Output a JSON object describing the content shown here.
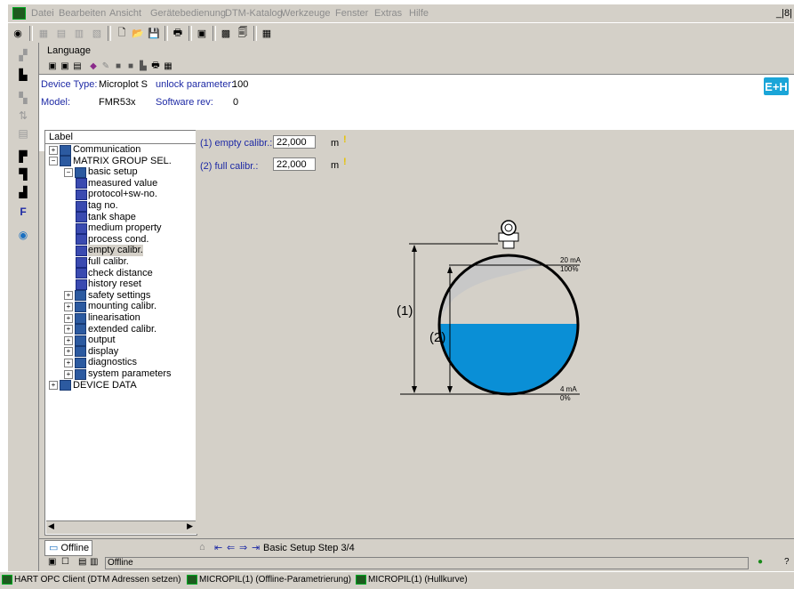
{
  "menu": {
    "items": [
      "Datei",
      "Bearbeiten",
      "Ansicht",
      "Gerätebedienung",
      "DTM-Katalog",
      "Werkzeuge",
      "Fenster",
      "Extras",
      "Hilfe"
    ],
    "window_controls": "_|8|"
  },
  "language_label": "Language",
  "device": {
    "type_label": "Device Type:",
    "type_value": "Microplot S",
    "unlock_label": "unlock parameter:",
    "unlock_value": "100",
    "model_label": "Model:",
    "model_value": "FMR53x",
    "sw_label": "Software rev:",
    "sw_value": "0",
    "logo_text": "E+H"
  },
  "tree": {
    "header": "Label",
    "items": [
      {
        "label": "Communication",
        "level": 0,
        "type": "folder",
        "expander": "+"
      },
      {
        "label": "MATRIX GROUP SEL.",
        "level": 0,
        "type": "folder",
        "expander": "−"
      },
      {
        "label": "basic setup",
        "level": 1,
        "type": "folder",
        "expander": "−"
      },
      {
        "label": "measured value",
        "level": 2,
        "type": "leaf"
      },
      {
        "label": "protocol+sw-no.",
        "level": 2,
        "type": "leaf"
      },
      {
        "label": "tag no.",
        "level": 2,
        "type": "leaf"
      },
      {
        "label": "tank shape",
        "level": 2,
        "type": "leaf"
      },
      {
        "label": "medium property",
        "level": 2,
        "type": "leaf"
      },
      {
        "label": "process cond.",
        "level": 2,
        "type": "leaf"
      },
      {
        "label": "empty calibr.",
        "level": 2,
        "type": "leaf",
        "selected": true
      },
      {
        "label": "full calibr.",
        "level": 2,
        "type": "leaf"
      },
      {
        "label": "check distance",
        "level": 2,
        "type": "leaf"
      },
      {
        "label": "history reset",
        "level": 2,
        "type": "leaf"
      },
      {
        "label": "safety settings",
        "level": 1,
        "type": "folder",
        "expander": "+"
      },
      {
        "label": "mounting calibr.",
        "level": 1,
        "type": "folder",
        "expander": "+"
      },
      {
        "label": "linearisation",
        "level": 1,
        "type": "folder",
        "expander": "+"
      },
      {
        "label": "extended calibr.",
        "level": 1,
        "type": "folder",
        "expander": "+"
      },
      {
        "label": "output",
        "level": 1,
        "type": "folder",
        "expander": "+"
      },
      {
        "label": "display",
        "level": 1,
        "type": "folder",
        "expander": "+"
      },
      {
        "label": "diagnostics",
        "level": 1,
        "type": "folder",
        "expander": "+"
      },
      {
        "label": "system parameters",
        "level": 1,
        "type": "folder",
        "expander": "+"
      },
      {
        "label": "DEVICE DATA",
        "level": 0,
        "type": "folder",
        "expander": "+"
      }
    ]
  },
  "params": {
    "empty_label": "(1) empty calibr.:",
    "empty_value": "22,000",
    "empty_unit": "m",
    "full_label": "(2) full calibr.:",
    "full_value": "22,000",
    "full_unit": "m"
  },
  "diagram": {
    "label_1": "(1)",
    "label_2": "(2)",
    "top_ma": "20 mA",
    "top_pct": "100%",
    "bot_ma": "4 mA",
    "bot_pct": "0%",
    "liquid_color": "#0a8fd6",
    "cone_color": "#c8c8c8"
  },
  "tabs": {
    "offline": "Offline"
  },
  "step_label": "Basic Setup Step 3/4",
  "status": {
    "text": "Offline"
  },
  "taskbar": {
    "items": [
      "HART OPC Client (DTM Adressen setzen)",
      "MICROPIL(1) (Offline-Parametrierung)",
      "MICROPIL(1) (Hullkurve)"
    ]
  }
}
